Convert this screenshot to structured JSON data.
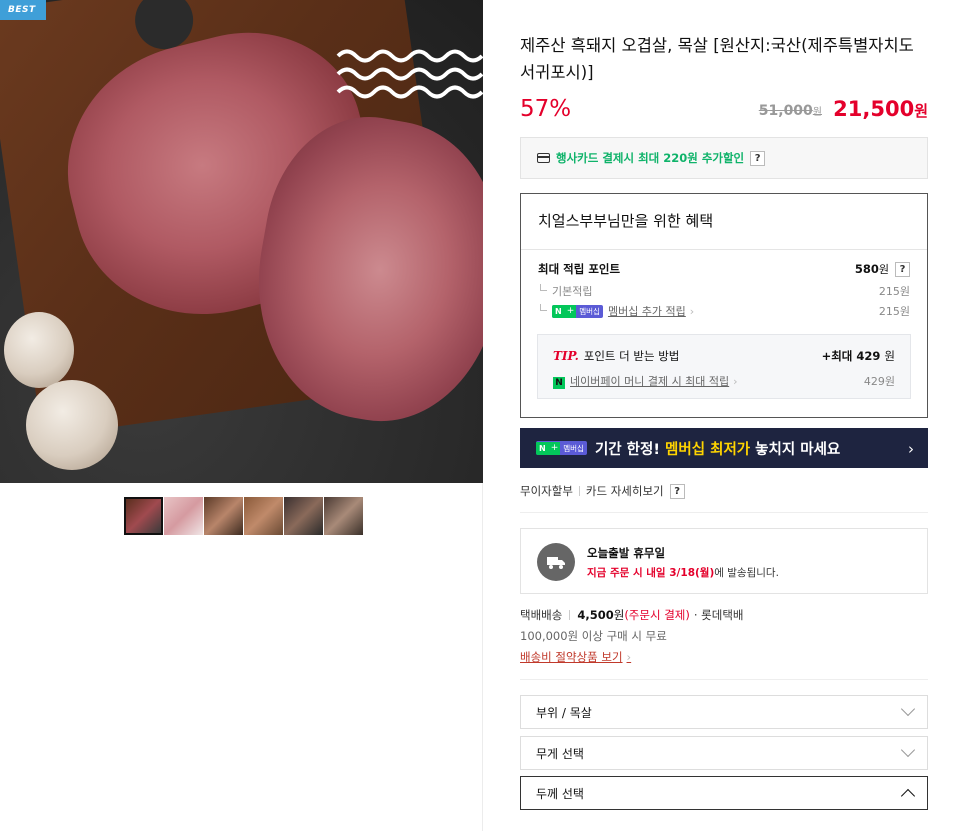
{
  "badge": {
    "best": "BEST"
  },
  "product": {
    "title": "제주산 흑돼지 오겹살, 목살 [원산지:국산(제주특별자치도 서귀포시)]",
    "discount": "57%",
    "original_price": "51,000",
    "original_won": "원",
    "price": "21,500",
    "price_won": "원"
  },
  "card_promo": {
    "text": "행사카드 결제시 최대 220원 추가할인",
    "help": "?"
  },
  "benefit": {
    "title": "치얼스부부님만을 위한 혜택",
    "max_point_label": "최대 적립 포인트",
    "max_point_value": "580",
    "max_point_won": "원",
    "help": "?",
    "basic_label": "기본적립",
    "basic_value": "215원",
    "member_badge_n": "N",
    "member_badge_plus": "+",
    "member_badge_m": "멤버십",
    "member_label": "멤버십 추가 적립",
    "member_value": "215원",
    "tip_mark": "TIP.",
    "tip_label": "포인트 더 받는 방법",
    "tip_max_prefix": "+최대",
    "tip_max_value": "429",
    "tip_max_won": "원",
    "npay_icon": "N",
    "npay_label": "네이버페이 머니 결제 시 최대 적립",
    "npay_value": "429원"
  },
  "banner": {
    "badge_n": "N",
    "badge_plus": "+",
    "badge_m": "멤버십",
    "text_before": "기간 한정! ",
    "text_highlight": "멤버십 최저가",
    "text_after": " 놓치지 마세요",
    "arrow": "›"
  },
  "payment": {
    "installment": "무이자할부",
    "card_detail": "카드 자세히보기",
    "help": "?"
  },
  "shipping": {
    "title": "오늘출발 휴무일",
    "order_red": "지금 주문 시 내일 3/18(월)",
    "order_rest": "에 발송됩니다."
  },
  "delivery": {
    "type": "택배배송",
    "fee": "4,500",
    "fee_won": "원",
    "fee_note": "(주문시 결제)",
    "carrier": "· 롯데택배",
    "free_condition": "100,000원 이상 구매 시 무료",
    "save_link": "배송비 절약상품 보기",
    "save_chev": "›"
  },
  "options": [
    {
      "label": "부위 / 목살"
    },
    {
      "label": "무게 선택"
    },
    {
      "label": "두께 선택"
    }
  ],
  "colors": {
    "accent_red": "#e4002b",
    "naver_green": "#03c75a",
    "banner_bg": "#1e2440",
    "banner_highlight": "#ffd400"
  }
}
